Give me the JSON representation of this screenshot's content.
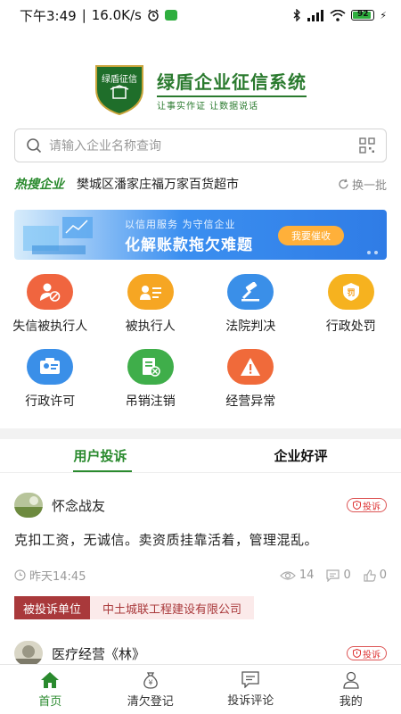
{
  "status_bar": {
    "time": "下午3:49",
    "speed": "16.0K/s",
    "battery": "92"
  },
  "brand": {
    "shield_text": "绿盾征信",
    "title": "绿盾企业征信系统",
    "slogan": "让事实作证  让数据说话"
  },
  "search": {
    "placeholder": "请输入企业名称查询"
  },
  "hot_search": {
    "label": "热搜企业",
    "company": "樊城区潘家庄福万家百货超市",
    "refresh": "换一批"
  },
  "banner": {
    "subtitle": "以信用服务  为守信企业",
    "title": "化解账款拖欠难题",
    "button": "我要催收"
  },
  "features": [
    {
      "label": "失信被执行人",
      "icon": "person-block-icon",
      "color": "#f0653f"
    },
    {
      "label": "被执行人",
      "icon": "id-card-icon",
      "color": "#f6a623"
    },
    {
      "label": "法院判决",
      "icon": "gavel-icon",
      "color": "#3a8fe8"
    },
    {
      "label": "行政处罚",
      "icon": "penalty-icon",
      "color": "#f6b21f"
    },
    {
      "label": "行政许可",
      "icon": "license-icon",
      "color": "#3a8fe8"
    },
    {
      "label": "吊销注销",
      "icon": "revoke-icon",
      "color": "#3fae4a"
    },
    {
      "label": "经营异常",
      "icon": "warning-icon",
      "color": "#f06a3a"
    }
  ],
  "tabs": [
    "用户投诉",
    "企业好评"
  ],
  "posts": [
    {
      "username": "怀念战友",
      "tag": "投诉",
      "content": "克扣工资，无诚信。卖资质挂靠活着，管理混乱。",
      "time": "昨天14:45",
      "views": "14",
      "comments": "0",
      "likes": "0",
      "target_label": "被投诉单位",
      "target_name": "中土城联工程建设有限公司"
    },
    {
      "username": "医疗经营《林》",
      "tag": "投诉"
    }
  ],
  "bottom_nav": [
    {
      "label": "首页",
      "icon": "home-icon"
    },
    {
      "label": "清欠登记",
      "icon": "money-bag-icon"
    },
    {
      "label": "投诉评论",
      "icon": "comment-icon"
    },
    {
      "label": "我的",
      "icon": "user-icon"
    }
  ],
  "colors": {
    "brand_green": "#2a8a2e",
    "complaint_red": "#a9393b",
    "banner_blue": "#2f7ce6"
  }
}
